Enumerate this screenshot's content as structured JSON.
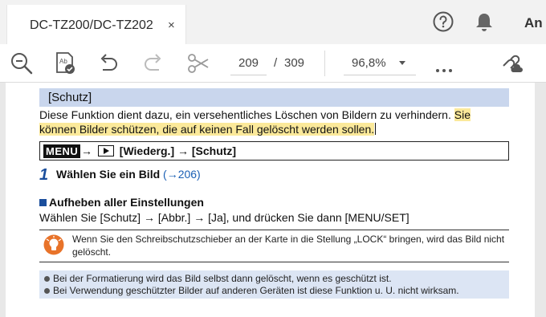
{
  "tab": {
    "title": "DC-TZ200/DC-TZ202",
    "close": "×"
  },
  "header": {
    "account_label": "An"
  },
  "toolbar": {
    "current_page": "209",
    "page_separator": "/",
    "total_pages": "309",
    "zoom": "96,8%"
  },
  "document": {
    "section_title": "[Schutz]",
    "intro_line1_plain": "Diese Funktion dient dazu, ein versehentliches Löschen von Bildern zu verhindern.",
    "intro_line1_highlight": "Sie",
    "intro_line2_highlight": "können Bilder schützen, die auf keinen Fall gelöscht werden sollen.",
    "menu_tag": "MENU",
    "menu_arrow1": "→",
    "menu_path_rest": "[Wiederg.] → [Schutz]",
    "step_number": "1",
    "step_text": "Wählen Sie ein Bild",
    "step_link": "(→206)",
    "subheading": "Aufheben aller Einstellungen",
    "sub_text": "Wählen Sie [Schutz] → [Abbr.] → [Ja], und drücken Sie dann [MENU/SET]",
    "note_text": "Wenn Sie den Schreibschutzschieber an der Karte in die Stellung „LOCK“ bringen, wird das Bild nicht gelöscht.",
    "info_items": [
      "Bei der Formatierung wird das Bild selbst dann gelöscht, wenn es geschützt ist.",
      "Bei Verwendung geschützter Bilder auf anderen Geräten ist diese Funktion u. U. nicht wirksam."
    ]
  },
  "colors": {
    "highlight": "#fbe99a",
    "section_bg": "#c9d6ed",
    "info_bg": "#dce5f4",
    "link": "#1a5fb4"
  }
}
